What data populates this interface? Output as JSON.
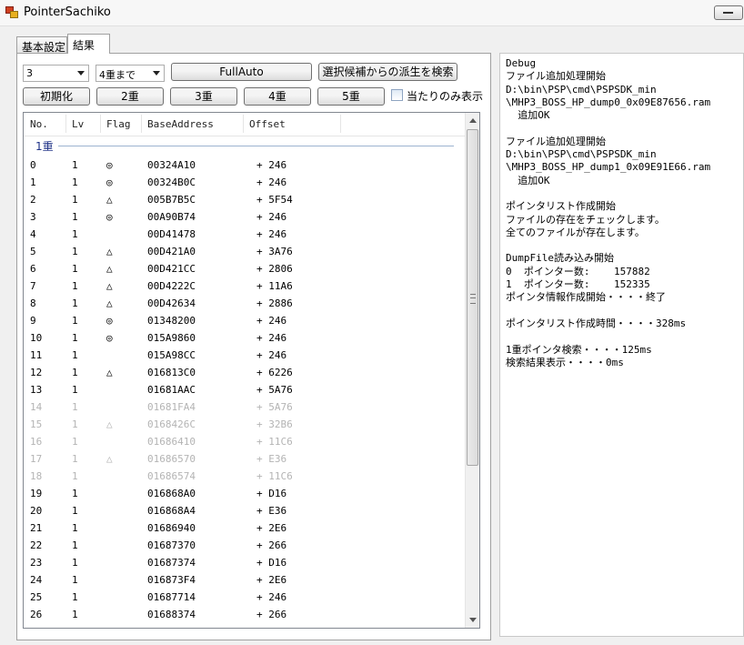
{
  "window": {
    "title": "PointerSachiko"
  },
  "tabs": [
    {
      "label": "基本設定"
    },
    {
      "label": "結果"
    }
  ],
  "controls": {
    "level_combo": "3",
    "depth_combo": "4重まで",
    "fullauto_button": "FullAuto",
    "derive_button": "選択候補からの派生を検索",
    "init_button": "初期化",
    "btn_2": "2重",
    "btn_3": "3重",
    "btn_4": "4重",
    "btn_5": "5重",
    "hits_only_label": "当たりのみ表示"
  },
  "table": {
    "columns": [
      "No.",
      "Lv",
      "Flag",
      "BaseAddress",
      "Offset"
    ],
    "group_label": "1重",
    "rows": [
      {
        "no": "0",
        "lv": "1",
        "flag": "◎",
        "base": "00324A10",
        "offset": "+ 246",
        "dim": false
      },
      {
        "no": "1",
        "lv": "1",
        "flag": "◎",
        "base": "00324B0C",
        "offset": "+ 246",
        "dim": false
      },
      {
        "no": "2",
        "lv": "1",
        "flag": "△",
        "base": "005B7B5C",
        "offset": "+ 5F54",
        "dim": false
      },
      {
        "no": "3",
        "lv": "1",
        "flag": "◎",
        "base": "00A90B74",
        "offset": "+ 246",
        "dim": false
      },
      {
        "no": "4",
        "lv": "1",
        "flag": "",
        "base": "00D41478",
        "offset": "+ 246",
        "dim": false
      },
      {
        "no": "5",
        "lv": "1",
        "flag": "△",
        "base": "00D421A0",
        "offset": "+ 3A76",
        "dim": false
      },
      {
        "no": "6",
        "lv": "1",
        "flag": "△",
        "base": "00D421CC",
        "offset": "+ 2806",
        "dim": false
      },
      {
        "no": "7",
        "lv": "1",
        "flag": "△",
        "base": "00D4222C",
        "offset": "+ 11A6",
        "dim": false
      },
      {
        "no": "8",
        "lv": "1",
        "flag": "△",
        "base": "00D42634",
        "offset": "+ 2886",
        "dim": false
      },
      {
        "no": "9",
        "lv": "1",
        "flag": "◎",
        "base": "01348200",
        "offset": "+ 246",
        "dim": false
      },
      {
        "no": "10",
        "lv": "1",
        "flag": "◎",
        "base": "015A9860",
        "offset": "+ 246",
        "dim": false
      },
      {
        "no": "11",
        "lv": "1",
        "flag": "",
        "base": "015A98CC",
        "offset": "+ 246",
        "dim": false
      },
      {
        "no": "12",
        "lv": "1",
        "flag": "△",
        "base": "016813C0",
        "offset": "+ 6226",
        "dim": false
      },
      {
        "no": "13",
        "lv": "1",
        "flag": "",
        "base": "01681AAC",
        "offset": "+ 5A76",
        "dim": false
      },
      {
        "no": "14",
        "lv": "1",
        "flag": "",
        "base": "01681FA4",
        "offset": "+ 5A76",
        "dim": true
      },
      {
        "no": "15",
        "lv": "1",
        "flag": "△",
        "base": "0168426C",
        "offset": "+ 32B6",
        "dim": true
      },
      {
        "no": "16",
        "lv": "1",
        "flag": "",
        "base": "01686410",
        "offset": "+ 11C6",
        "dim": true
      },
      {
        "no": "17",
        "lv": "1",
        "flag": "△",
        "base": "01686570",
        "offset": "+ E36",
        "dim": true
      },
      {
        "no": "18",
        "lv": "1",
        "flag": "",
        "base": "01686574",
        "offset": "+ 11C6",
        "dim": true
      },
      {
        "no": "19",
        "lv": "1",
        "flag": "",
        "base": "016868A0",
        "offset": "+ D16",
        "dim": false
      },
      {
        "no": "20",
        "lv": "1",
        "flag": "",
        "base": "016868A4",
        "offset": "+ E36",
        "dim": false
      },
      {
        "no": "21",
        "lv": "1",
        "flag": "",
        "base": "01686940",
        "offset": "+ 2E6",
        "dim": false
      },
      {
        "no": "22",
        "lv": "1",
        "flag": "",
        "base": "01687370",
        "offset": "+ 266",
        "dim": false
      },
      {
        "no": "23",
        "lv": "1",
        "flag": "",
        "base": "01687374",
        "offset": "+ D16",
        "dim": false
      },
      {
        "no": "24",
        "lv": "1",
        "flag": "",
        "base": "016873F4",
        "offset": "+ 2E6",
        "dim": false
      },
      {
        "no": "25",
        "lv": "1",
        "flag": "",
        "base": "01687714",
        "offset": "+ 246",
        "dim": false
      },
      {
        "no": "26",
        "lv": "1",
        "flag": "",
        "base": "01688374",
        "offset": "+ 266",
        "dim": false
      }
    ]
  },
  "debug_log": [
    "Debug",
    "ファイル追加処理開始",
    "D:\\bin\\PSP\\cmd\\PSPSDK_min",
    "\\MHP3_BOSS_HP_dump0_0x09E87656.ram",
    "  追加OK",
    "",
    "ファイル追加処理開始",
    "D:\\bin\\PSP\\cmd\\PSPSDK_min",
    "\\MHP3_BOSS_HP_dump1_0x09E91E66.ram",
    "  追加OK",
    "",
    "ポインタリスト作成開始",
    "ファイルの存在をチェックします。",
    "全てのファイルが存在します。",
    "",
    "DumpFile読み込み開始",
    "0  ポインター数:    157882",
    "1  ポインター数:    152335",
    "ポインタ情報作成開始・・・・終了",
    "",
    "ポインタリスト作成時間・・・・328ms",
    "",
    "1重ポインタ検索・・・・125ms",
    "検索結果表示・・・・0ms"
  ]
}
